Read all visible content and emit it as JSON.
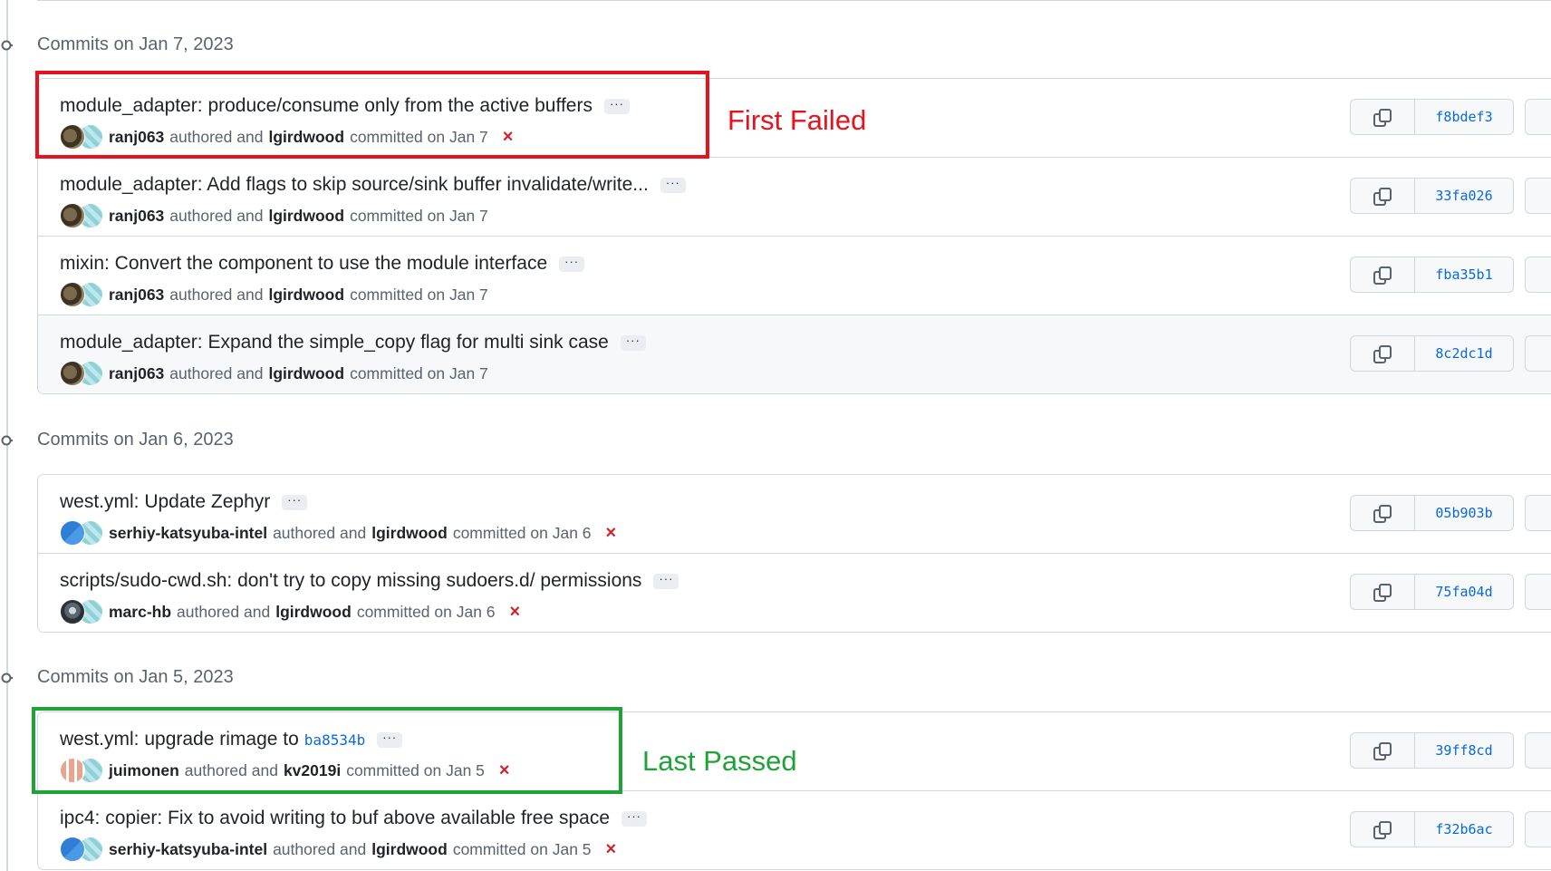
{
  "groups": [
    {
      "title": "Commits on Jan 7, 2023",
      "commits": [
        {
          "message": "module_adapter: produce/consume only from the active buffers",
          "author": "ranj063",
          "authored_text": "authored and",
          "committer": "lgirdwood",
          "committed_text": "committed on Jan 7",
          "status": "×",
          "sha": "f8bdef3"
        },
        {
          "message": "module_adapter: Add flags to skip source/sink buffer invalidate/write...",
          "author": "ranj063",
          "authored_text": "authored and",
          "committer": "lgirdwood",
          "committed_text": "committed on Jan 7",
          "sha": "33fa026"
        },
        {
          "message": "mixin: Convert the component to use the module interface",
          "author": "ranj063",
          "authored_text": "authored and",
          "committer": "lgirdwood",
          "committed_text": "committed on Jan 7",
          "sha": "fba35b1"
        },
        {
          "message": "module_adapter: Expand the simple_copy flag for multi sink case",
          "author": "ranj063",
          "authored_text": "authored and",
          "committer": "lgirdwood",
          "committed_text": "committed on Jan 7",
          "sha": "8c2dc1d"
        }
      ]
    },
    {
      "title": "Commits on Jan 6, 2023",
      "commits": [
        {
          "message": "west.yml: Update Zephyr",
          "author": "serhiy-katsyuba-intel",
          "authored_text": "authored and",
          "committer": "lgirdwood",
          "committed_text": "committed on Jan 6",
          "status": "×",
          "sha": "05b903b"
        },
        {
          "message": "scripts/sudo-cwd.sh: don't try to copy missing sudoers.d/ permissions",
          "author": "marc-hb",
          "authored_text": "authored and",
          "committer": "lgirdwood",
          "committed_text": "committed on Jan 6",
          "status": "×",
          "sha": "75fa04d"
        }
      ]
    },
    {
      "title": "Commits on Jan 5, 2023",
      "commits": [
        {
          "message": "west.yml: upgrade rimage to",
          "message_link": "ba8534b",
          "author": "juimonen",
          "authored_text": "authored and",
          "committer": "kv2019i",
          "committed_text": "committed on Jan 5",
          "status": "×",
          "sha": "39ff8cd"
        },
        {
          "message": "ipc4: copier: Fix to avoid writing to buf above available free space",
          "author": "serhiy-katsyuba-intel",
          "authored_text": "authored and",
          "committer": "lgirdwood",
          "committed_text": "committed on Jan 5",
          "status": "×",
          "sha": "f32b6ac"
        }
      ]
    }
  ],
  "ellipsis": "···",
  "annotations": {
    "first_failed": "First Failed",
    "last_passed": "Last Passed"
  },
  "colors": {
    "failed_box": "#e8121e",
    "passed_box": "#1fa336",
    "status_fail": "#cf222e",
    "sha_link": "#0969da"
  },
  "icons": {
    "timeline": "git-commit-icon",
    "copy": "copy-icon",
    "status": "x-icon"
  }
}
